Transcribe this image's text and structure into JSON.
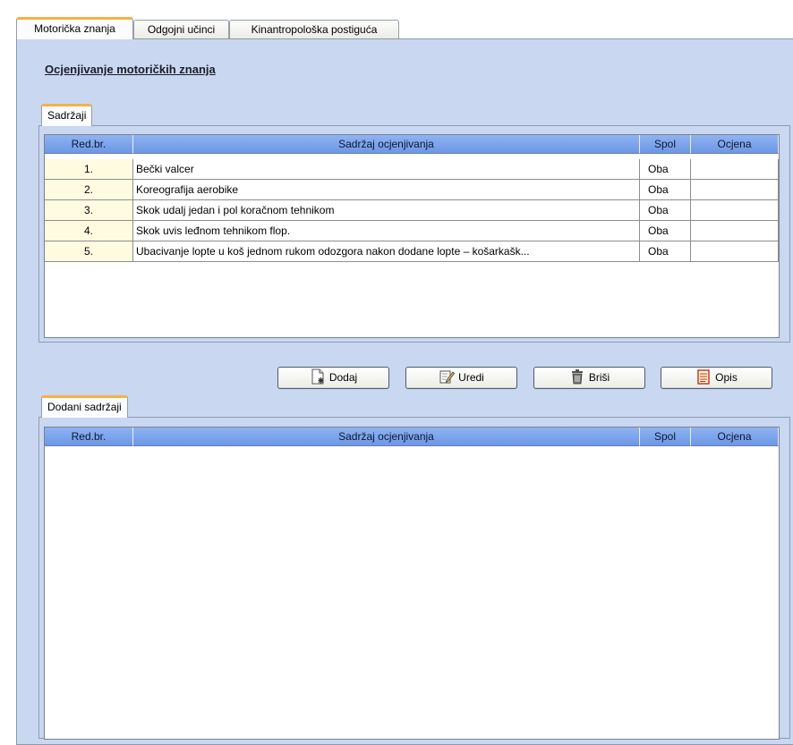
{
  "tabs": [
    {
      "label": "Motorička znanja",
      "active": true
    },
    {
      "label": "Odgojni učinci",
      "active": false
    },
    {
      "label": "Kinantropološka postiguća",
      "active": false
    }
  ],
  "page_title": "Ocjenjivanje motoričkih znanja",
  "sadrzaji": {
    "tab_label": "Sadržaji",
    "columns": [
      "Red.br.",
      "Sadržaj ocjenjivanja",
      "Spol",
      "Ocjena"
    ],
    "rows": [
      {
        "num": "1.",
        "content": "Bečki valcer",
        "spol": "Oba",
        "ocjena": ""
      },
      {
        "num": "2.",
        "content": "Koreografija aerobike",
        "spol": "Oba",
        "ocjena": ""
      },
      {
        "num": "3.",
        "content": "Skok udalj jedan i pol koračnom tehnikom",
        "spol": "Oba",
        "ocjena": ""
      },
      {
        "num": "4.",
        "content": "Skok uvis leđnom tehnikom flop.",
        "spol": "Oba",
        "ocjena": ""
      },
      {
        "num": "5.",
        "content": "Ubacivanje lopte u koš jednom rukom odozgora nakon dodane lopte – košarkašk...",
        "spol": "Oba",
        "ocjena": ""
      }
    ]
  },
  "buttons": {
    "dodaj": "Dodaj",
    "uredi": "Uredi",
    "brisi": "Briši",
    "opis": "Opis"
  },
  "dodani": {
    "tab_label": "Dodani sadržaji",
    "columns": [
      "Red.br.",
      "Sadržaj ocjenjivanja",
      "Spol",
      "Ocjena"
    ],
    "rows": []
  },
  "icons": {
    "dodaj": "add-document-icon",
    "uredi": "edit-pencil-icon",
    "brisi": "trash-icon",
    "opis": "description-notepad-icon"
  },
  "colors": {
    "panel_bg": "#c9d7f1",
    "header_blue": "#7aa3ea",
    "active_tab_accent": "#f6b143",
    "row_number_bg": "#fefbe0"
  }
}
